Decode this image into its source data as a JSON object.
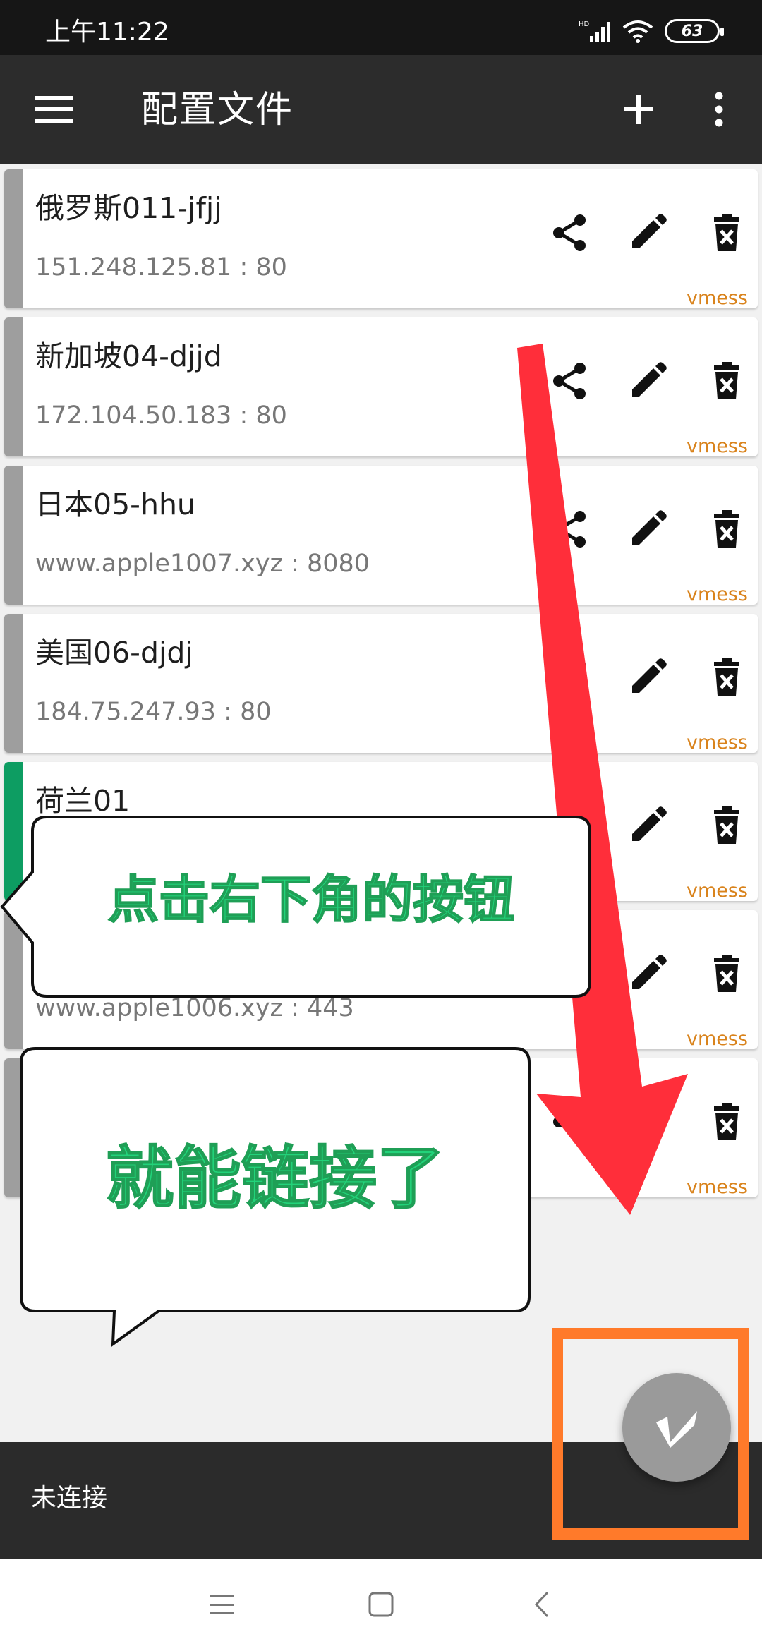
{
  "status_bar": {
    "time": "上午11:22",
    "battery": "63"
  },
  "app_bar": {
    "title": "配置文件"
  },
  "servers": [
    {
      "name": "俄罗斯011-jfjj",
      "address": "151.248.125.81 : 80",
      "type": "vmess",
      "active": false
    },
    {
      "name": "新加坡04-djjd",
      "address": "172.104.50.183 : 80",
      "type": "vmess",
      "active": false
    },
    {
      "name": "日本05-hhu",
      "address": "www.apple1007.xyz : 8080",
      "type": "vmess",
      "active": false
    },
    {
      "name": "美国06-djdj",
      "address": "184.75.247.93 : 80",
      "type": "vmess",
      "active": false
    },
    {
      "name": "荷兰01",
      "address": "",
      "type": "vmess",
      "active": true
    },
    {
      "name": "",
      "address": "www.apple1006.xyz : 443",
      "type": "vmess",
      "active": false
    },
    {
      "name": "",
      "address": "",
      "type": "vmess",
      "active": false
    }
  ],
  "bottom_bar": {
    "status": "未连接"
  },
  "callouts": {
    "first": "点击右下角的按钮",
    "second": "就能链接了"
  },
  "colors": {
    "accent_active": "#0d9d62",
    "protocol": "#d9831c",
    "arrow": "#ff3333",
    "highlight": "#ff7a2a",
    "callout_text": "#22d37a"
  }
}
